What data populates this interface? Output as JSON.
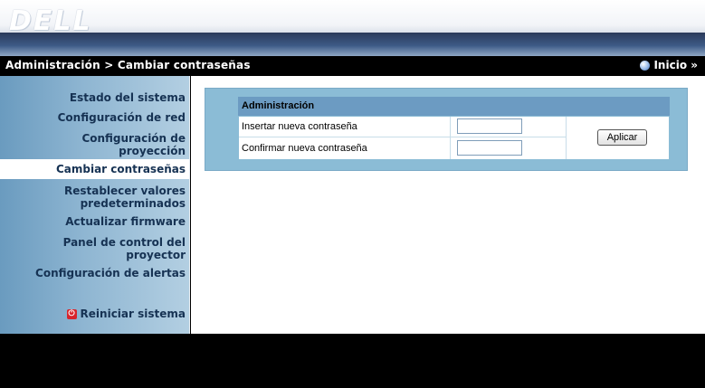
{
  "brand": {
    "logo_text": "DELL"
  },
  "titlebar": {
    "breadcrumb": "Administración > Cambiar contraseñas",
    "home_label": "Inicio »"
  },
  "sidebar": {
    "items": [
      {
        "label": "Estado del sistema"
      },
      {
        "label": "Configuración de red"
      },
      {
        "label": "Configuración de proyección"
      },
      {
        "label": "Cambiar contraseñas",
        "active": true
      },
      {
        "label": "Restablecer valores predeterminados"
      },
      {
        "label": "Actualizar firmware"
      },
      {
        "label": "Panel de control del proyector"
      },
      {
        "label": "Configuración de alertas"
      }
    ],
    "restart_label": "Reiniciar sistema"
  },
  "panel": {
    "title": "Administración",
    "fields": [
      {
        "label": "Insertar nueva contraseña",
        "value": ""
      },
      {
        "label": "Confirmar nueva contraseña",
        "value": ""
      }
    ],
    "apply_label": "Aplicar"
  },
  "colors": {
    "sidebar": "#8fb6d2",
    "panel": "#8bbcd6",
    "panel_header": "#6c9bc2",
    "nav_text": "#163253",
    "restart_icon": "#d8242c"
  },
  "icons": {
    "home": "home-dot-icon",
    "restart": "power-icon"
  }
}
